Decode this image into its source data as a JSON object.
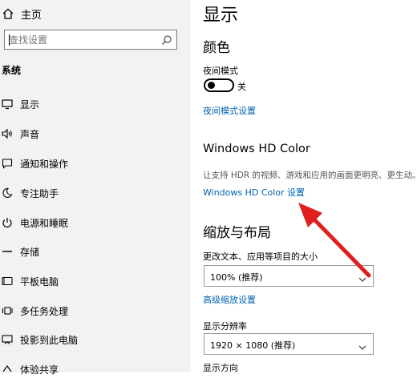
{
  "sidebar": {
    "home_label": "主页",
    "search_placeholder": "查找设置",
    "section_title": "系统",
    "items": [
      {
        "label": "显示",
        "icon": "monitor-icon"
      },
      {
        "label": "声音",
        "icon": "speaker-icon"
      },
      {
        "label": "通知和操作",
        "icon": "notification-icon"
      },
      {
        "label": "专注助手",
        "icon": "moon-icon"
      },
      {
        "label": "电源和睡眠",
        "icon": "power-icon"
      },
      {
        "label": "存储",
        "icon": "storage-icon"
      },
      {
        "label": "平板电脑",
        "icon": "tablet-icon"
      },
      {
        "label": "多任务处理",
        "icon": "multitask-icon"
      },
      {
        "label": "投影到此电脑",
        "icon": "project-icon"
      },
      {
        "label": "体验共享",
        "icon": "share-icon"
      }
    ]
  },
  "main": {
    "page_title": "显示",
    "color_heading": "颜色",
    "night_mode_label": "夜间模式",
    "night_mode_state": "关",
    "night_mode_settings_link": "夜间模式设置",
    "hdr_heading": "Windows HD Color",
    "hdr_description": "让支持 HDR 的视频、游戏和应用的画面更明亮、更生动。",
    "hdr_settings_link": "Windows HD Color 设置",
    "scale_heading": "缩放与布局",
    "scale_label": "更改文本、应用等项目的大小",
    "scale_value": "100% (推荐)",
    "advanced_scale_link": "高级缩放设置",
    "resolution_label": "显示分辨率",
    "resolution_value": "1920 × 1080 (推荐)",
    "orientation_label": "显示方向"
  },
  "colors": {
    "accent_link": "#0063b1",
    "annotation_arrow": "#e02020"
  }
}
